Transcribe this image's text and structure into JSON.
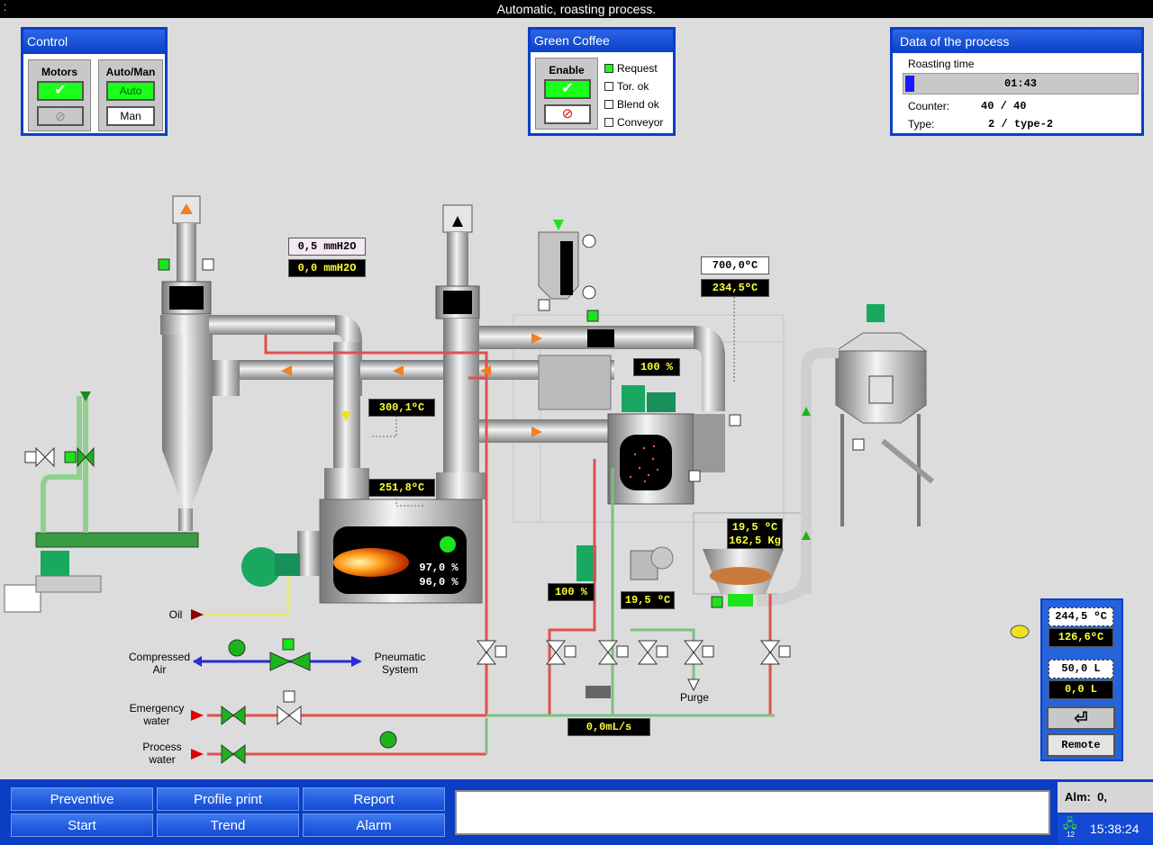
{
  "window": {
    "title": "Automatic, roasting process."
  },
  "control": {
    "title": "Control",
    "motors_label": "Motors",
    "automan_label": "Auto/Man",
    "auto_button": "Auto",
    "man_button": "Man"
  },
  "green_coffee": {
    "title": "Green Coffee",
    "enable_label": "Enable",
    "checks": [
      {
        "label": "Request",
        "checked": true
      },
      {
        "label": "Tor. ok",
        "checked": false
      },
      {
        "label": "Blend ok",
        "checked": false
      },
      {
        "label": "Conveyor",
        "checked": false
      }
    ]
  },
  "process_data": {
    "title": "Data of the process",
    "roasting_time_label": "Roasting time",
    "roasting_time": "01:43",
    "roasting_progress": 0.03,
    "counter_label": "Counter:",
    "counter_value": "40",
    "counter_sep": "/",
    "counter_total": "40",
    "type_label": "Type:",
    "type_value": "2",
    "type_sep": "/",
    "type_name": "type-2"
  },
  "readings": {
    "pressure_setpoint": "0,5 mmH2O",
    "pressure_actual": "0,0 mmH2O",
    "temp_setpoint": "700,0ºC",
    "temp_actual": "234,5ºC",
    "fan_speed": "100 %",
    "temp_300": "300,1ºC",
    "temp_251": "251,8ºC",
    "burner_1": "97,0 %",
    "burner_2": "96,0 %",
    "cooler_temp": "19,5 ºC",
    "cooler_weight": "162,5 Kg",
    "cooler_fan": "100 %",
    "cooler_air_temp": "19,5 ºC",
    "water_flow": "0,0mL/s"
  },
  "labels": {
    "oil": "Oil",
    "compressed_air": "Compressed\nAir",
    "pneumatic_system": "Pneumatic\nSystem",
    "emergency_water": "Emergency\nwater",
    "process_water": "Process\nwater",
    "purge": "Purge"
  },
  "right_panel": {
    "temp_setpoint": "244,5 ºC",
    "temp_actual": "126,6ºC",
    "volume_setpoint": "50,0 L",
    "volume_actual": "0,0 L",
    "remote_button": "Remote"
  },
  "bottom": {
    "buttons_row1": [
      "Preventive",
      "Profile print",
      "Report"
    ],
    "buttons_row2": [
      "Start",
      "Trend",
      "Alarm"
    ],
    "alarm_label": "Alm:",
    "alarm_count": "0,",
    "time": "15:38:24",
    "network_count": "12"
  },
  "colors": {
    "accent": "#0a3fc8",
    "active_green": "#1bff1b",
    "display_text": "#ffff33"
  }
}
